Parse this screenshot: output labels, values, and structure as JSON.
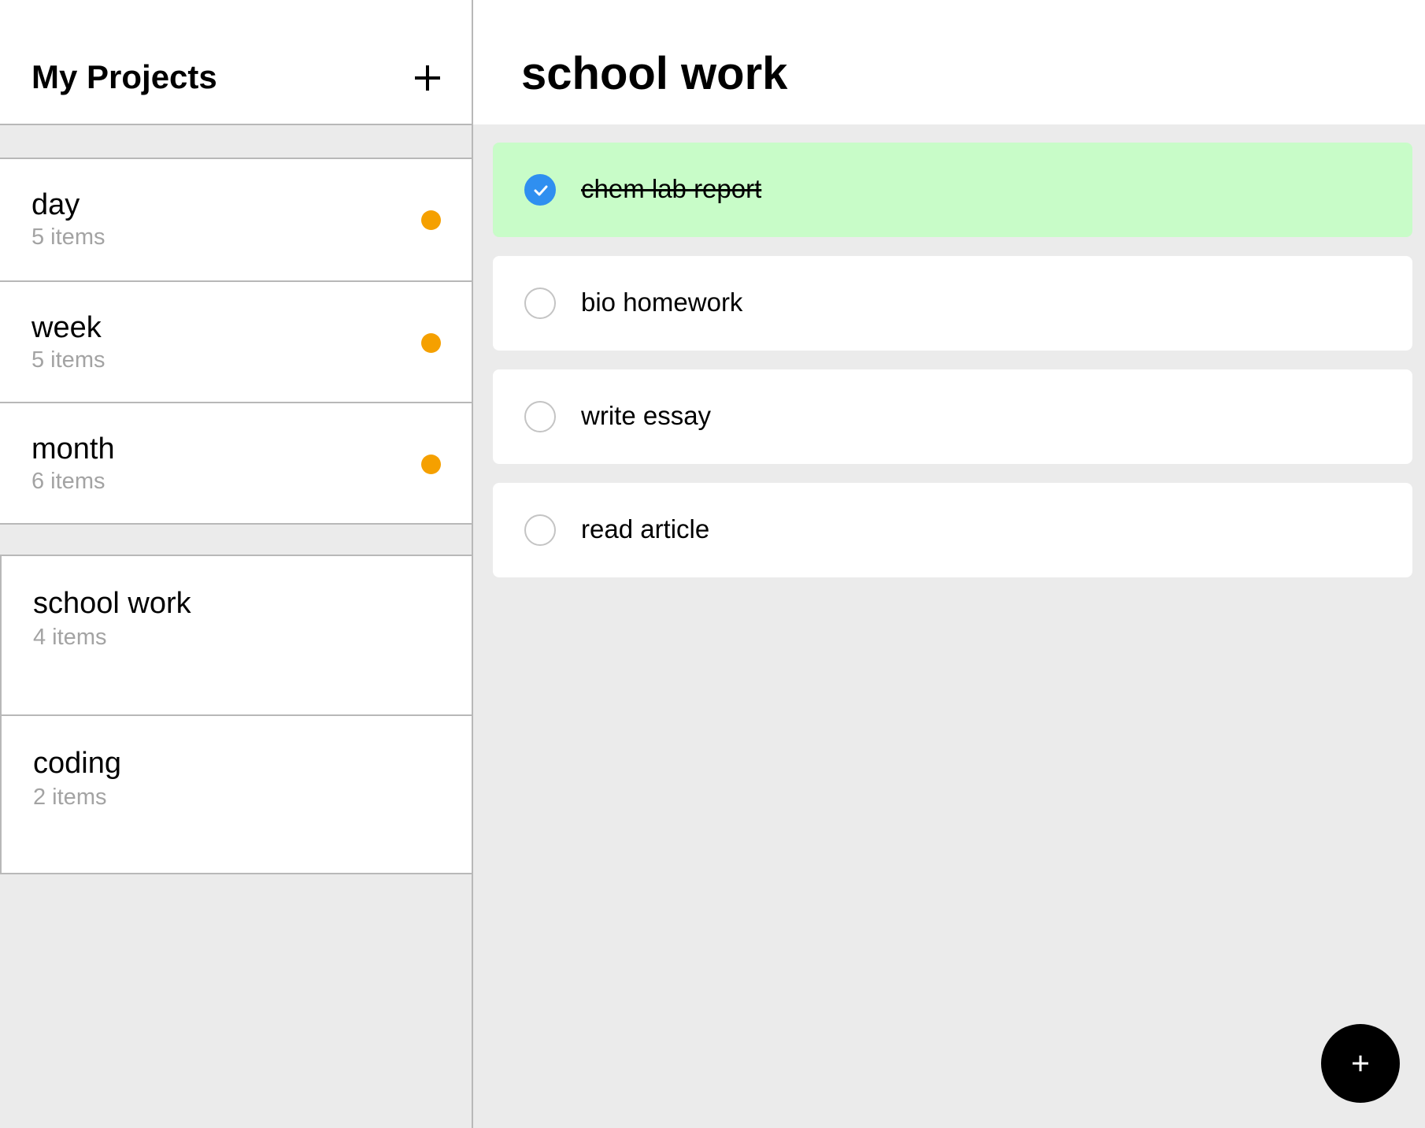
{
  "sidebar": {
    "title": "My Projects",
    "add_icon": "plus-icon",
    "time_views": [
      {
        "name": "day",
        "count": "5 items",
        "dot_color": "#f5a000"
      },
      {
        "name": "week",
        "count": "5 items",
        "dot_color": "#f5a000"
      },
      {
        "name": "month",
        "count": "6 items",
        "dot_color": "#f5a000"
      }
    ],
    "projects": [
      {
        "name": "school work",
        "count": "4 items"
      },
      {
        "name": "coding",
        "count": "2 items"
      }
    ]
  },
  "main": {
    "title": "school work",
    "tasks": [
      {
        "label": "chem lab report",
        "done": true
      },
      {
        "label": "bio homework",
        "done": false
      },
      {
        "label": "write essay",
        "done": false
      },
      {
        "label": "read article",
        "done": false
      }
    ],
    "fab_icon": "plus-icon"
  },
  "colors": {
    "accent_check": "#2f8ff0",
    "done_background": "#c8fcc8",
    "status_dot": "#f5a000"
  }
}
